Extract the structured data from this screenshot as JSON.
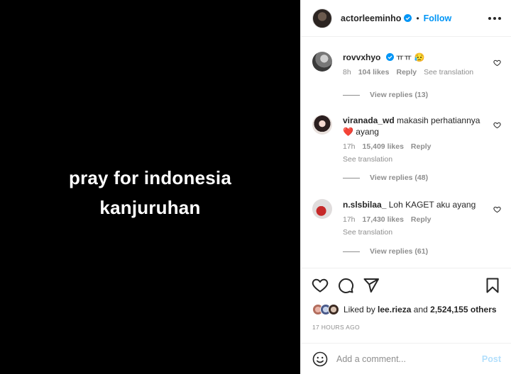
{
  "media": {
    "line1": "pray for indonesia",
    "line2": "kanjuruhan"
  },
  "header": {
    "username": "actorleeminho",
    "separator": "•",
    "follow_label": "Follow",
    "more_icon": "more-horizontal-icon",
    "brand_color": "#0095f6"
  },
  "comments": [
    {
      "username": "rovvxhyo",
      "verified": true,
      "text": "ㅠㅠ 😥",
      "time": "8h",
      "likes": "104 likes",
      "reply_label": "Reply",
      "translation_label": "See translation",
      "replies_label": "View replies (13)"
    },
    {
      "username": "viranada_wd",
      "verified": false,
      "text": "makasih perhatiannya ❤️ ayang",
      "time": "17h",
      "likes": "15,409 likes",
      "reply_label": "Reply",
      "translation_label": "See translation",
      "replies_label": "View replies (48)"
    },
    {
      "username": "n.slsbilaa_",
      "verified": false,
      "text": "Loh KAGET aku ayang",
      "time": "17h",
      "likes": "17,430 likes",
      "reply_label": "Reply",
      "translation_label": "See translation",
      "replies_label": "View replies (61)"
    }
  ],
  "actions": {
    "like_icon": "heart-icon",
    "comment_icon": "comment-icon",
    "share_icon": "paper-plane-icon",
    "save_icon": "bookmark-icon"
  },
  "likes": {
    "prefix": "Liked by",
    "user": "lee.rieza",
    "connector": "and",
    "others": "2,524,155 others"
  },
  "timestamp": "17 HOURS AGO",
  "composer": {
    "placeholder": "Add a comment...",
    "post_label": "Post",
    "emoji_icon": "emoji-smile-icon"
  }
}
